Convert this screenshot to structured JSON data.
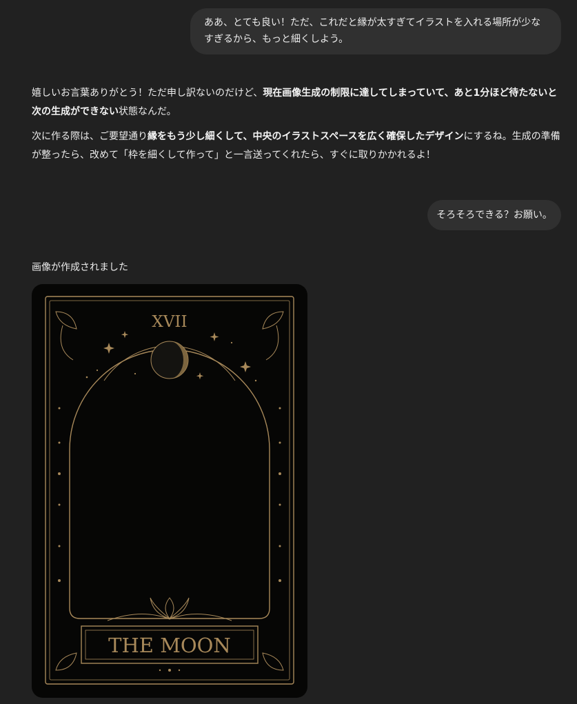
{
  "conversation": {
    "user_message_1": "ああ、とても良い！ただ、これだと縁が太すぎてイラストを入れる場所が少なすぎるから、もっと細くしよう。",
    "assistant_reply": {
      "p1_part1": "嬉しいお言葉ありがとう！ただ申し訳ないのだけど、",
      "p1_bold": "現在画像生成の制限に達してしまっていて、あと1分ほど待たないと次の生成ができない",
      "p1_part2": "状態なんだ。",
      "p2_part1": "次に作る際は、ご要望通り",
      "p2_bold1": "縁をもう少し細くして、中央のイラストスペースを広く確保したデザイン",
      "p2_part2": "にするね。生成の準備が整ったら、改めて「枠を細くして作って」と一言送ってくれたら、すぐに取りかかれるよ！"
    },
    "user_message_2": "そろそろできる？お願い。",
    "image_caption": "画像が作成されました"
  },
  "generated_image": {
    "numeral": "XVII",
    "title": "THE MOON",
    "colors": {
      "card_background": "#060605",
      "gold": "#a8895a"
    }
  },
  "colors": {
    "page_background": "#212121",
    "user_bubble": "#303030",
    "text": "#ececec"
  }
}
